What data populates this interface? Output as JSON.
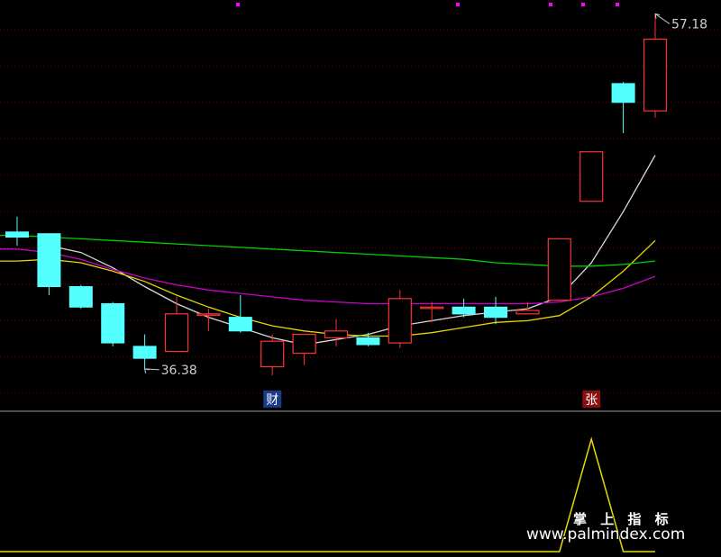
{
  "chart_data": {
    "type": "candlestick",
    "price_range": [
      34.0,
      58.0
    ],
    "candles": [
      {
        "open": 44.4,
        "high": 45.3,
        "low": 43.6,
        "close": 44.1
      },
      {
        "open": 44.3,
        "high": 44.3,
        "low": 40.7,
        "close": 41.2
      },
      {
        "open": 41.2,
        "high": 41.3,
        "low": 39.9,
        "close": 40.0
      },
      {
        "open": 40.2,
        "high": 40.3,
        "low": 37.7,
        "close": 37.9
      },
      {
        "open": 37.7,
        "high": 38.4,
        "low": 36.38,
        "close": 37.0
      },
      {
        "open": 37.4,
        "high": 40.6,
        "low": 37.4,
        "close": 39.6
      },
      {
        "open": 39.6,
        "high": 39.9,
        "low": 38.6,
        "close": 39.6
      },
      {
        "open": 39.4,
        "high": 40.7,
        "low": 38.5,
        "close": 38.6
      },
      {
        "open": 36.5,
        "high": 38.4,
        "low": 36.0,
        "close": 38.0
      },
      {
        "open": 37.3,
        "high": 38.4,
        "low": 36.6,
        "close": 38.4
      },
      {
        "open": 38.2,
        "high": 39.3,
        "low": 37.7,
        "close": 38.6
      },
      {
        "open": 38.2,
        "high": 38.5,
        "low": 37.7,
        "close": 37.8
      },
      {
        "open": 37.9,
        "high": 41.0,
        "low": 37.6,
        "close": 40.5
      },
      {
        "open": 40.0,
        "high": 40.3,
        "low": 39.1,
        "close": 40.0
      },
      {
        "open": 40.0,
        "high": 40.5,
        "low": 39.4,
        "close": 39.6
      },
      {
        "open": 40.0,
        "high": 40.6,
        "low": 39.0,
        "close": 39.4
      },
      {
        "open": 39.6,
        "high": 40.3,
        "low": 39.6,
        "close": 39.8
      },
      {
        "open": 40.4,
        "high": 44.0,
        "low": 40.4,
        "close": 44.0
      },
      {
        "open": 46.2,
        "high": 49.1,
        "low": 46.2,
        "close": 49.1
      },
      {
        "open": 53.1,
        "high": 53.2,
        "low": 50.2,
        "close": 52.0
      },
      {
        "open": 51.5,
        "high": 57.18,
        "low": 51.1,
        "close": 55.7
      }
    ],
    "ma_series": [
      {
        "color": "#d8d8d8",
        "values": [
          null,
          43.6,
          43.2,
          42.3,
          41.2,
          40.2,
          39.4,
          38.8,
          38.2,
          37.8,
          38.1,
          38.4,
          38.9,
          39.2,
          39.5,
          39.7,
          39.9,
          40.6,
          42.6,
          45.6,
          48.9
        ]
      },
      {
        "color": "#e6d800",
        "values": [
          42.7,
          42.8,
          42.6,
          42.1,
          41.5,
          40.7,
          40.0,
          39.4,
          38.9,
          38.6,
          38.4,
          38.3,
          38.3,
          38.5,
          38.8,
          39.1,
          39.2,
          39.5,
          40.6,
          42.1,
          43.9
        ]
      },
      {
        "color": "#cc00cc",
        "values": [
          43.4,
          43.2,
          42.8,
          42.2,
          41.7,
          41.3,
          41.0,
          40.8,
          40.6,
          40.4,
          40.3,
          40.2,
          40.2,
          40.2,
          40.2,
          40.2,
          40.2,
          40.3,
          40.6,
          41.1,
          41.8
        ]
      },
      {
        "color": "#00d000",
        "values": [
          44.2,
          44.1,
          44.0,
          43.9,
          43.8,
          43.7,
          43.6,
          43.5,
          43.4,
          43.3,
          43.2,
          43.1,
          43.0,
          42.9,
          42.8,
          42.6,
          42.5,
          42.4,
          42.4,
          42.5,
          42.7
        ]
      }
    ],
    "annotations": [
      {
        "text": "57.18",
        "candle": 20,
        "kind": "high"
      },
      {
        "text": "36.38",
        "candle": 4,
        "kind": "low"
      }
    ],
    "markers": [
      {
        "text": "财",
        "candle": 8,
        "color": "#1a3a8a"
      },
      {
        "text": "张",
        "candle": 18,
        "color": "#8a1010"
      }
    ],
    "indicator": {
      "color": "#e6d800",
      "range": [
        0,
        1
      ],
      "values": [
        0,
        0,
        0,
        0,
        0,
        0,
        0,
        0,
        0,
        0,
        0,
        0,
        0,
        0,
        0,
        0,
        0,
        0,
        1,
        0,
        0
      ]
    }
  },
  "watermark": {
    "line1": "掌 上 指 标",
    "line2": "www.palmindex.com"
  }
}
